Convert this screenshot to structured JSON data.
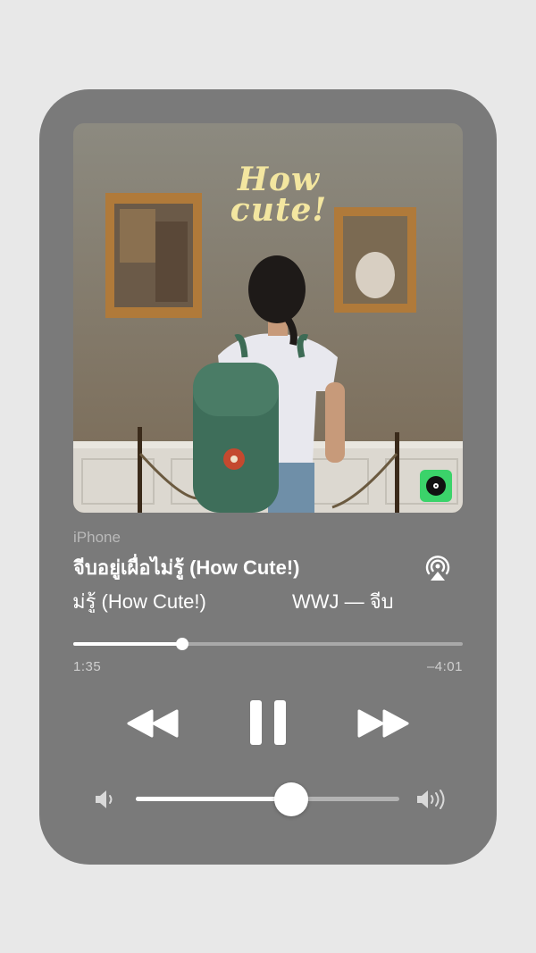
{
  "artwork": {
    "text_line1": "How",
    "text_line2": "cute!",
    "badge_icon": "vinyl-record-icon"
  },
  "player": {
    "source": "iPhone",
    "song_title": "จีบอยู่เผื่อไม่รู้ (How Cute!)",
    "marquee_part1": "ไม่รู้ (How Cute!)",
    "marquee_part2": "WWJ — จีบ",
    "time_elapsed": "1:35",
    "time_remaining": "–4:01",
    "progress_fraction": 0.28,
    "volume_fraction": 0.59
  },
  "icons": {
    "airplay": "airplay-icon",
    "rewind": "rewind-icon",
    "pause": "pause-icon",
    "forward": "fast-forward-icon",
    "volume_low": "volume-low-icon",
    "volume_high": "volume-high-icon"
  },
  "colors": {
    "card": "#7a7a7a",
    "accent_title": "#f3e6a0",
    "badge": "#3bd36a"
  }
}
